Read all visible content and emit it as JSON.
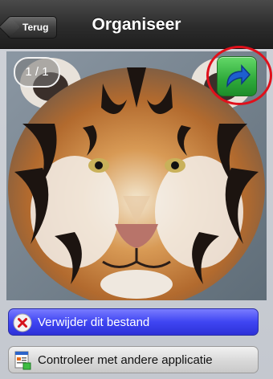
{
  "nav": {
    "title": "Organiseer",
    "back_label": "Terug"
  },
  "viewer": {
    "page_counter": "1 / 1",
    "image_subject": "tiger-face-photo"
  },
  "actions": {
    "delete_label": "Verwijder dit bestand",
    "open_with_label": "Controleer met andere applicatie"
  },
  "icons": {
    "share": "share-arrow-icon",
    "delete": "x-circle-icon",
    "open_with": "document-app-icon"
  },
  "colors": {
    "nav_bar": "#2c2c2c",
    "share_button": "#2ea93a",
    "delete_button": "#3f45f2",
    "highlight_circle": "#e0101b"
  }
}
